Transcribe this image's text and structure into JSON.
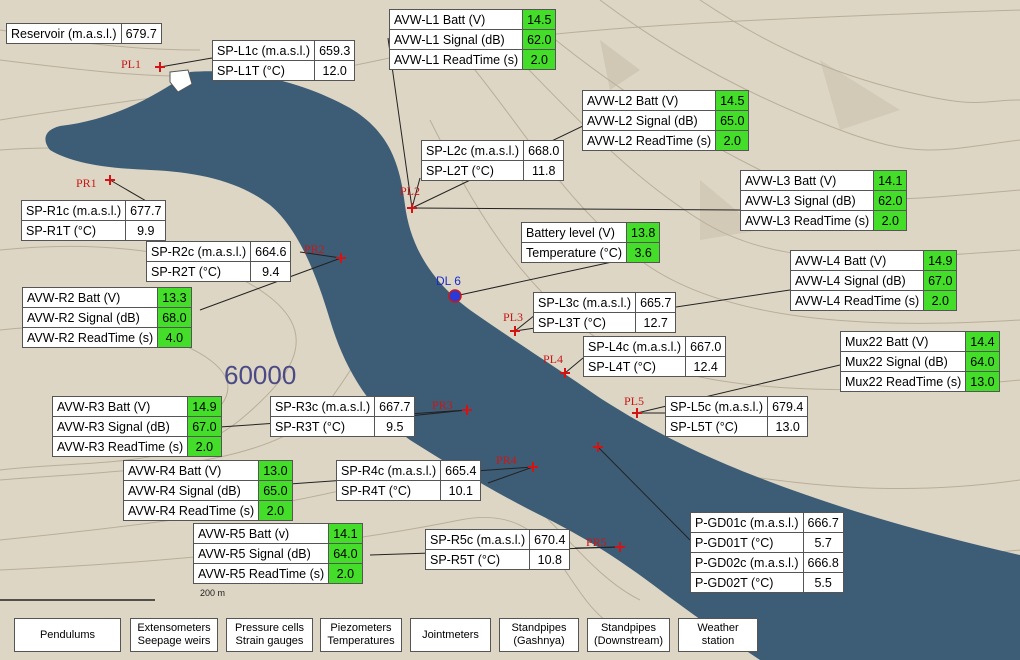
{
  "reservoir": {
    "label": "Reservoir (m.a.s.l.)",
    "value": "679.7"
  },
  "topo_label": "60000",
  "scale_label": "200 m",
  "dl6_label": "DL 6",
  "points": {
    "PL1": "PL1",
    "PL2": "PL2",
    "PL3": "PL3",
    "PL4": "PL4",
    "PL5": "PL5",
    "PR1": "PR1",
    "PR2": "PR2",
    "PR3": "PR3",
    "PR4": "PR4",
    "PR5": "PR5"
  },
  "tables": {
    "sp_l1": [
      {
        "l": "SP-L1c (m.a.s.l.)",
        "v": "659.3"
      },
      {
        "l": "SP-L1T (°C)",
        "v": "12.0"
      }
    ],
    "sp_l2": [
      {
        "l": "SP-L2c (m.a.s.l.)",
        "v": "668.0"
      },
      {
        "l": "SP-L2T (°C)",
        "v": "11.8"
      }
    ],
    "sp_l3": [
      {
        "l": "SP-L3c (m.a.s.l.)",
        "v": "665.7"
      },
      {
        "l": "SP-L3T (°C)",
        "v": "12.7"
      }
    ],
    "sp_l4": [
      {
        "l": "SP-L4c (m.a.s.l.)",
        "v": "667.0"
      },
      {
        "l": "SP-L4T (°C)",
        "v": "12.4"
      }
    ],
    "sp_l5": [
      {
        "l": "SP-L5c (m.a.s.l.)",
        "v": "679.4"
      },
      {
        "l": "SP-L5T (°C)",
        "v": "13.0"
      }
    ],
    "sp_r1": [
      {
        "l": "SP-R1c (m.a.s.l.)",
        "v": "677.7"
      },
      {
        "l": "SP-R1T (°C)",
        "v": "9.9"
      }
    ],
    "sp_r2": [
      {
        "l": "SP-R2c (m.a.s.l.)",
        "v": "664.6"
      },
      {
        "l": "SP-R2T (°C)",
        "v": "9.4"
      }
    ],
    "sp_r3": [
      {
        "l": "SP-R3c (m.a.s.l.)",
        "v": "667.7"
      },
      {
        "l": "SP-R3T (°C)",
        "v": "9.5"
      }
    ],
    "sp_r4": [
      {
        "l": "SP-R4c (m.a.s.l.)",
        "v": "665.4"
      },
      {
        "l": "SP-R4T (°C)",
        "v": "10.1"
      }
    ],
    "sp_r5": [
      {
        "l": "SP-R5c (m.a.s.l.)",
        "v": "670.4"
      },
      {
        "l": "SP-R5T (°C)",
        "v": "10.8"
      }
    ],
    "avw_l1": [
      {
        "l": "AVW-L1 Batt (V)",
        "v": "14.5"
      },
      {
        "l": "AVW-L1 Signal (dB)",
        "v": "62.0"
      },
      {
        "l": "AVW-L1 ReadTime (s)",
        "v": "2.0"
      }
    ],
    "avw_l2": [
      {
        "l": "AVW-L2 Batt (V)",
        "v": "14.5"
      },
      {
        "l": "AVW-L2 Signal (dB)",
        "v": "65.0"
      },
      {
        "l": "AVW-L2 ReadTime (s)",
        "v": "2.0"
      }
    ],
    "avw_l3": [
      {
        "l": "AVW-L3 Batt (V)",
        "v": "14.1"
      },
      {
        "l": "AVW-L3 Signal (dB)",
        "v": "62.0"
      },
      {
        "l": "AVW-L3 ReadTime (s)",
        "v": "2.0"
      }
    ],
    "avw_l4": [
      {
        "l": "AVW-L4 Batt (V)",
        "v": "14.9"
      },
      {
        "l": "AVW-L4 Signal (dB)",
        "v": "67.0"
      },
      {
        "l": "AVW-L4 ReadTime (s)",
        "v": "2.0"
      }
    ],
    "mux22": [
      {
        "l": "Mux22 Batt (V)",
        "v": "14.4"
      },
      {
        "l": "Mux22 Signal (dB)",
        "v": "64.0"
      },
      {
        "l": "Mux22 ReadTime (s)",
        "v": "13.0"
      }
    ],
    "avw_r2": [
      {
        "l": "AVW-R2 Batt (V)",
        "v": "13.3"
      },
      {
        "l": "AVW-R2 Signal (dB)",
        "v": "68.0"
      },
      {
        "l": "AVW-R2 ReadTime (s)",
        "v": "4.0"
      }
    ],
    "avw_r3": [
      {
        "l": "AVW-R3 Batt (V)",
        "v": "14.9"
      },
      {
        "l": "AVW-R3 Signal (dB)",
        "v": "67.0"
      },
      {
        "l": "AVW-R3 ReadTime (s)",
        "v": "2.0"
      }
    ],
    "avw_r4": [
      {
        "l": "AVW-R4 Batt (V)",
        "v": "13.0"
      },
      {
        "l": "AVW-R4 Signal (dB)",
        "v": "65.0"
      },
      {
        "l": "AVW-R4 ReadTime (s)",
        "v": "2.0"
      }
    ],
    "avw_r5": [
      {
        "l": "AVW-R5 Batt (v)",
        "v": "14.1"
      },
      {
        "l": "AVW-R5 Signal (dB)",
        "v": "64.0"
      },
      {
        "l": "AVW-R5 ReadTime (s)",
        "v": "2.0"
      }
    ],
    "dl6": [
      {
        "l": "Battery level (V)",
        "v": "13.8"
      },
      {
        "l": "Temperature (°C)",
        "v": "3.6"
      }
    ],
    "pgd": [
      {
        "l": "P-GD01c (m.a.s.l.)",
        "v": "666.7"
      },
      {
        "l": "P-GD01T (°C)",
        "v": "5.7"
      },
      {
        "l": "P-GD02c (m.a.s.l.)",
        "v": "666.8"
      },
      {
        "l": "P-GD02T (°C)",
        "v": "5.5"
      }
    ]
  },
  "nav_buttons": [
    {
      "label": "Pendulums"
    },
    {
      "label": "Extensometers\nSeepage weirs"
    },
    {
      "label": "Pressure cells\nStrain gauges"
    },
    {
      "label": "Piezometers\nTemperatures"
    },
    {
      "label": "Jointmeters"
    },
    {
      "label": "Standpipes\n(Gashnya)"
    },
    {
      "label": "Standpipes\n(Downstream)"
    },
    {
      "label": "Weather\nstation"
    }
  ],
  "colors": {
    "water": "#3d5c76",
    "terrain": "#ded7c7",
    "highlight": "#44dd2a",
    "marker": "#d41414"
  }
}
